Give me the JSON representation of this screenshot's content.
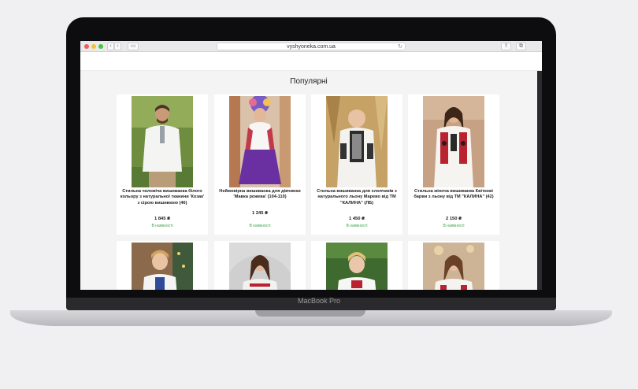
{
  "browser": {
    "url": "vyshyoneka.com.ua",
    "back_glyph": "‹",
    "forward_glyph": "›",
    "sidebar_glyph": "▭",
    "reload_glyph": "↻",
    "share_glyph": "⇧",
    "tabs_glyph": "⧉"
  },
  "laptop": {
    "brand": "MacBook Pro"
  },
  "section": {
    "title": "Популярні"
  },
  "products": [
    {
      "name": "Стильна чоловіча вишиванка білого кольору з натуральної тканини 'Козак' з сірою вишивкою (46)",
      "price": "1 845 ₴",
      "stock": "В наявності"
    },
    {
      "name": "Неймовірна вишиванка для дівчинки 'Мавка рожева' (104-110)",
      "price": "1 245 ₴",
      "stock": "В наявності"
    },
    {
      "name": "Стильна вишиванка для хлопчиків з натурального льону Марево від ТМ \"КАЛИНА\" (ЛБ)",
      "price": "1 450 ₴",
      "stock": "В наявності"
    },
    {
      "name": "Стильна жіноча вишиванка Квіткові барви з льону від ТМ \"КАЛИНА\" (42)",
      "price": "2 150 ₴",
      "stock": "В наявності"
    }
  ],
  "colors": {
    "stock_green": "#3aa34a",
    "bezel": "#0d0d0f",
    "page_bg": "#f4f4f5"
  }
}
